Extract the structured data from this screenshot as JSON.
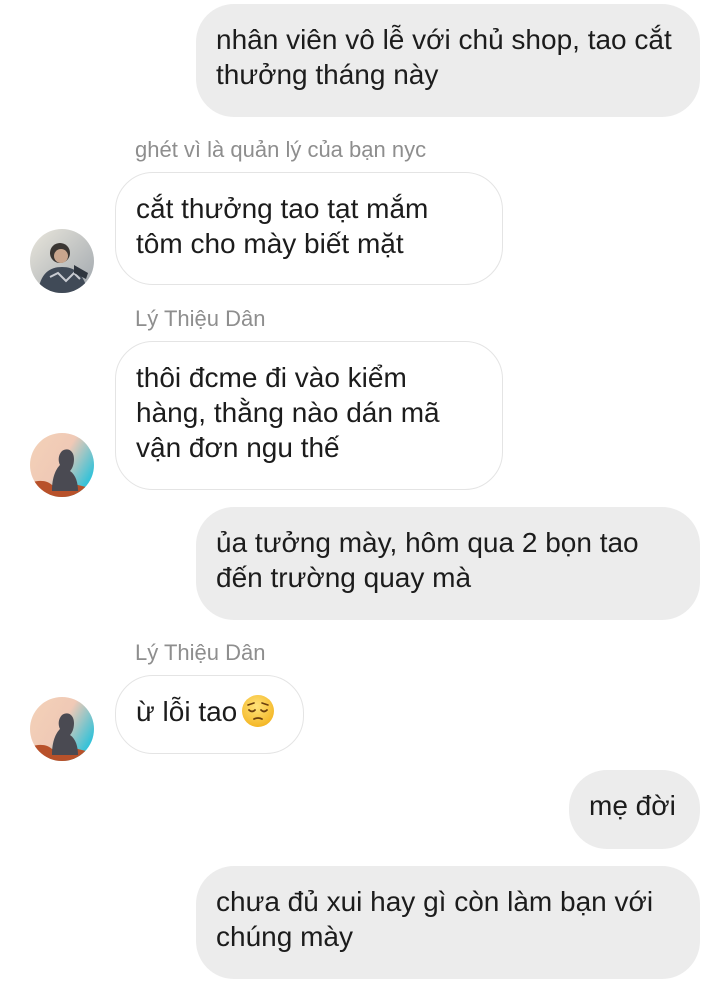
{
  "messages": [
    {
      "side": "out",
      "text": "nhân viên vô lễ với chủ shop, tao cắt thưởng tháng này"
    },
    {
      "side": "in",
      "sender": "ghét vì là quản lý của bạn nyc",
      "text": "cắt thưởng tao tạt mắm tôm cho mày biết mặt"
    },
    {
      "side": "in",
      "sender": "Lý Thiệu Dân",
      "text": "thôi đcme đi vào kiểm hàng, thằng nào dán mã vận đơn ngu thế"
    },
    {
      "side": "out",
      "text": "ủa tưởng mày, hôm qua 2 bọn tao đến trường quay mà"
    },
    {
      "side": "in",
      "sender": "Lý Thiệu Dân",
      "text": "ừ lỗi tao",
      "emoji": "pensive-face-emoji"
    },
    {
      "side": "out",
      "text": "mẹ đời"
    },
    {
      "side": "out",
      "text": "chưa đủ xui hay gì còn làm bạn với chúng mày"
    }
  ],
  "avatars": {
    "first": "person-photo-avatar",
    "second": "silhouette-avatar"
  },
  "colors": {
    "outgoing_bubble": "#ececec",
    "incoming_bubble_border": "#e4e4e4",
    "sender_name": "#8e8e8e",
    "text": "#1c1c1c"
  }
}
